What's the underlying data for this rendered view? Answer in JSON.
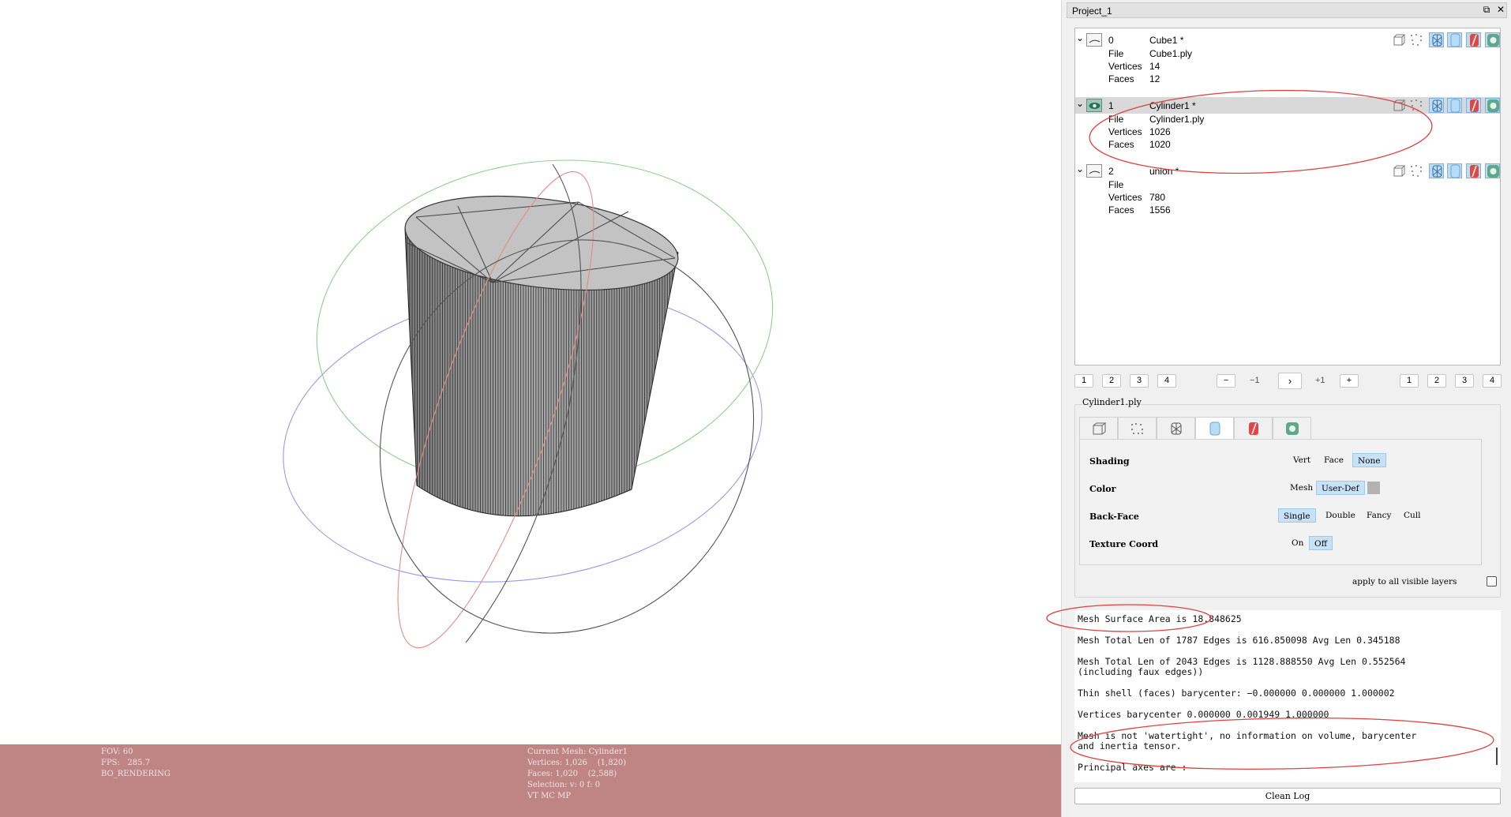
{
  "dock": {
    "title": "Project_1",
    "float_btn": "⧉",
    "close_btn": "✕"
  },
  "layers": [
    {
      "id": "0",
      "name": "Cube1 *",
      "file_key": "File",
      "file": "Cube1.ply",
      "vertices_key": "Vertices",
      "vertices": "14",
      "faces_key": "Faces",
      "faces": "12",
      "visible": false,
      "selected": false
    },
    {
      "id": "1",
      "name": "Cylinder1 *",
      "file_key": "File",
      "file": "Cylinder1.ply",
      "vertices_key": "Vertices",
      "vertices": "1026",
      "faces_key": "Faces",
      "faces": "1020",
      "visible": true,
      "selected": true
    },
    {
      "id": "2",
      "name": "union *",
      "file_key": "File",
      "file": "",
      "vertices_key": "Vertices",
      "vertices": "780",
      "faces_key": "Faces",
      "faces": "1556",
      "visible": false,
      "selected": false
    }
  ],
  "pager": {
    "left": [
      "1",
      "2",
      "3",
      "4"
    ],
    "minus": "−",
    "minus_one": "−1",
    "next": "›",
    "plus_one": "+1",
    "plus": "+",
    "right": [
      "1",
      "2",
      "3",
      "4"
    ]
  },
  "render_panel": {
    "title": "Cylinder1.ply",
    "active_tab": "solid",
    "rows": {
      "shading": {
        "label": "Shading",
        "options": [
          "Vert",
          "Face",
          "None"
        ],
        "selected": "None"
      },
      "color": {
        "label": "Color",
        "options": [
          "Mesh",
          "User-Def"
        ],
        "selected": "User-Def"
      },
      "backface": {
        "label": "Back-Face",
        "options": [
          "Single",
          "Double",
          "Fancy",
          "Cull"
        ],
        "selected": "Single"
      },
      "texcoord": {
        "label": "Texture Coord",
        "options": [
          "On",
          "Off"
        ],
        "selected": "Off"
      }
    },
    "apply_label": "apply to all visible layers",
    "apply_checked": false
  },
  "log": {
    "lines": [
      "Mesh Surface Area is 18.848625",
      "Mesh Total Len of 1787 Edges is 616.850098 Avg Len 0.345188",
      "Mesh Total Len of 2043 Edges is 1128.888550 Avg Len 0.552564",
      "(including faux edges))",
      "Thin shell (faces) barycenter: −0.000000 0.000000 1.000002",
      "Vertices barycenter 0.000000 0.001949 1.000000",
      "Mesh is not 'watertight', no information on volume, barycenter",
      "and inertia tensor.",
      "Principal axes are :"
    ],
    "clean_button": "Clean Log"
  },
  "status": {
    "fov": "FOV: 60",
    "fps": "FPS:   285.7",
    "mode": "BO_RENDERING",
    "current_mesh": "Current Mesh: Cylinder1",
    "vertices": "Vertices: 1,026    (1,820)",
    "faces": "Faces: 1,020    (2,588)",
    "selection": "Selection: v: 0 f: 0",
    "flags": "VT MC MP"
  },
  "colors": {
    "status_bg": "#bf8584",
    "annotation": "#e04040",
    "highlight": "#c7e2f7",
    "trackball_x": "#e88a8a",
    "trackball_y": "#8fcf8f",
    "trackball_z": "#9a9ae8"
  }
}
